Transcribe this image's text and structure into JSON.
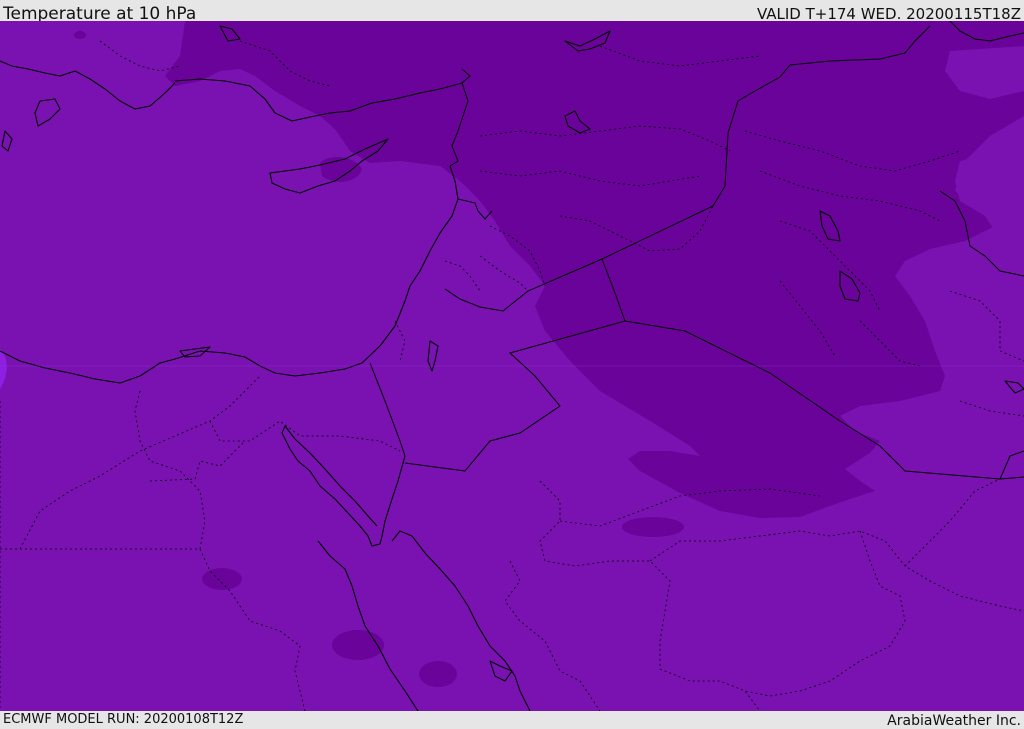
{
  "header": {
    "title": "Temperature at 10 hPa",
    "valid_time": "VALID T+174 WED. 20200115T18Z"
  },
  "footer": {
    "model_run": "ECMWF MODEL RUN: 20200108T12Z",
    "brand": "ArabiaWeather Inc."
  },
  "map": {
    "field_colors": {
      "base": "#7a12b2",
      "cold": "#690399",
      "warm_edge": "#8e1fe2"
    },
    "line_color": "#000000"
  }
}
